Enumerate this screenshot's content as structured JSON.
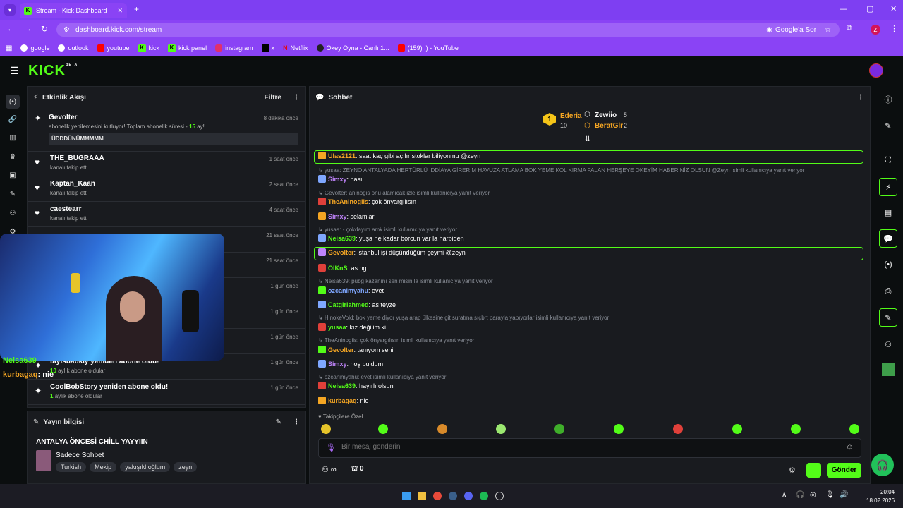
{
  "browser": {
    "tab_title": "Stream - Kick Dashboard",
    "url": "dashboard.kick.com/stream",
    "google_ask": "Google'a Sor",
    "profile_letter": "Z",
    "bookmarks": [
      "google",
      "outlook",
      "youtube",
      "kick",
      "kick panel",
      "instagram",
      "x",
      "Netflix",
      "Okey Oyna - Canlı 1...",
      "(159) ;) - YouTube"
    ]
  },
  "app": {
    "logo": "KICK",
    "beta": "BETA"
  },
  "activity": {
    "title": "Etkinlik Akışı",
    "filter": "Filtre",
    "sub_name": "Gevolter",
    "sub_time": "8 dakika önce",
    "sub_text_a": "abonelik yenilemesini kutluyor! Toplam abonelik süresi - ",
    "sub_months": "15",
    "sub_text_b": " ay!",
    "sub_message": "ÜDDDÜNÜMMMMM",
    "items": [
      {
        "name": "THE_BUGRAAA",
        "sub": "kanalı takip etti",
        "time": "1 saat önce"
      },
      {
        "name": "Kaptan_Kaan",
        "sub": "kanalı takip etti",
        "time": "2 saat önce"
      },
      {
        "name": "caestearr",
        "sub": "kanalı takip etti",
        "time": "4 saat önce"
      },
      {
        "name": "",
        "sub": "",
        "time": "21 saat önce"
      },
      {
        "name": "",
        "sub": "",
        "time": "21 saat önce"
      },
      {
        "name": "",
        "sub": "",
        "time": "1 gün önce"
      },
      {
        "name": "",
        "sub": "",
        "time": "1 gün önce"
      },
      {
        "name": "",
        "sub": "",
        "time": "1 gün önce"
      },
      {
        "name": "taylsbabkly yeniden abone oldu!",
        "sub_num": "10",
        "sub": "aylık abone oldular",
        "time": "1 gün önce"
      },
      {
        "name": "CoolBobStory yeniden abone oldu!",
        "sub_num": "1",
        "sub": "aylık abone oldular",
        "time": "1 gün önce"
      }
    ]
  },
  "overlay_chat": {
    "line1": "Neisa639",
    "line2_user": "kurbagaq",
    "line2_text": ": nie"
  },
  "stream_info": {
    "title": "Yayın bilgisi",
    "stream_title": "ANTALYA ÖNCESİ CHİLL YAYYIIN",
    "category": "Sadece Sohbet",
    "tags": [
      "Turkish",
      "Mekip",
      "yakışıklıoğlum",
      "zeyn"
    ]
  },
  "chat": {
    "title": "Sohbet",
    "leaders": [
      {
        "rank": "1",
        "name": "Ederia",
        "count": "10"
      },
      {
        "rank": "",
        "name": "Zewiio",
        "count": "5"
      },
      {
        "rank": "",
        "name": "BeratGlr",
        "count": "2"
      }
    ],
    "messages": [
      {
        "type": "hl",
        "user": "Ulas2121",
        "color": "#f5a623",
        "text": ": saat kaç gibi açılır stoklar biliyonmu @zeyn"
      },
      {
        "type": "rep",
        "text": "↳ yusaa: ZEYNO ANTALYADA HERTÜRLÜ İDDİAYA GİRERİM HAVUZA ATLAMA BOK YEME KOL KIRMA FALAN HERŞEYE OKEYİM HABERİNİZ OLSUN @Zeyn isimli kullanıcıya yanıt veriyor"
      },
      {
        "type": "msg",
        "user": "Simxy",
        "color": "#c084fc",
        "text": ": nası"
      },
      {
        "type": "rep",
        "text": "↳ Gevolter: aninogis onu alamıcak izle isimli kullanıcıya yanıt veriyor"
      },
      {
        "type": "msg",
        "user": "TheAninogiis",
        "color": "#f5a623",
        "text": ": çok önyargılısın"
      },
      {
        "type": "msg",
        "user": "Simxy",
        "color": "#c084fc",
        "text": ": selamlar"
      },
      {
        "type": "rep",
        "text": "↳ yusaa: - çokdayım amk isimli kullanıcıya yanıt veriyor"
      },
      {
        "type": "msg",
        "user": "Neisa639",
        "color": "#53fc18",
        "text": ": yuşa ne kadar borcun var la harbiden"
      },
      {
        "type": "hl",
        "user": "Gevolter",
        "color": "#f5a623",
        "text": ": istanbul işi düşündüğüm şeymi @zeyn"
      },
      {
        "type": "msg",
        "user": "OIKnS",
        "color": "#53fc18",
        "text": ": as hg"
      },
      {
        "type": "rep",
        "text": "↳ Neisa639: pubg kazanını sen misin la isimli kullanıcıya yanıt veriyor"
      },
      {
        "type": "msg",
        "user": "ozcanimyahu",
        "color": "#7fa7ff",
        "text": ": evet"
      },
      {
        "type": "msg",
        "user": "Catgirlahmed",
        "color": "#53fc18",
        "text": ": as teyze"
      },
      {
        "type": "rep",
        "text": "↳ HinokeVold: bok yeme diyor yuşa arap ülkesine git suratına sıçbrt parayla yapıyorlar isimli kullanıcıya yanıt veriyor"
      },
      {
        "type": "msg",
        "user": "yusaa",
        "color": "#53fc18",
        "text": ": kız değilim ki"
      },
      {
        "type": "rep",
        "text": "↳ TheAninogiis: çok önyargılısın isimli kullanıcıya yanıt veriyor"
      },
      {
        "type": "msg",
        "user": "Gevolter",
        "color": "#f5a623",
        "text": ": tanıyom seni"
      },
      {
        "type": "msg",
        "user": "Simxy",
        "color": "#c084fc",
        "text": ": hoş buldum"
      },
      {
        "type": "rep",
        "text": "↳ ozcanimyahu: evet isimli kullanıcıya yanıt veriyor"
      },
      {
        "type": "msg",
        "user": "Neisa639",
        "color": "#53fc18",
        "text": ": hayırlı olsun"
      },
      {
        "type": "msg",
        "user": "kurbagaq",
        "color": "#f5a623",
        "text": ": nie"
      }
    ],
    "followers_only": "Takipçilere Özel",
    "placeholder": "Bir mesaj gönderin",
    "viewers": "∞",
    "points": "0",
    "send": "Gönder"
  },
  "taskbar": {
    "time": "20:04",
    "date": "18.02.2026"
  },
  "colors": {
    "accent": "#53fc18",
    "browser": "#8a43f5"
  }
}
